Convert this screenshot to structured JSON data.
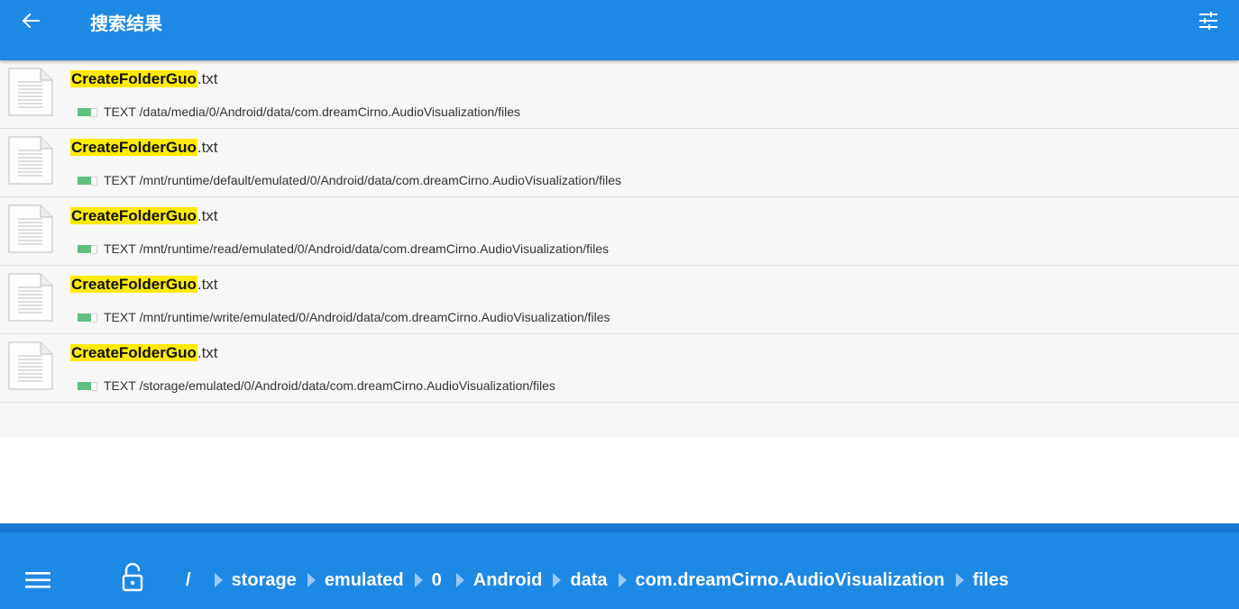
{
  "app_bar": {
    "title": "搜索结果",
    "back_icon": "arrow-left-icon",
    "filter_icon": "tune-sliders-icon",
    "color": "#1e88e5"
  },
  "results": [
    {
      "name_highlight": "CreateFolderGuo",
      "name_rest": ".txt",
      "type": "TEXT",
      "path": "/data/media/0/Android/data/com.dreamCirno.AudioVisualization/files"
    },
    {
      "name_highlight": "CreateFolderGuo",
      "name_rest": ".txt",
      "type": "TEXT",
      "path": "/mnt/runtime/default/emulated/0/Android/data/com.dreamCirno.AudioVisualization/files"
    },
    {
      "name_highlight": "CreateFolderGuo",
      "name_rest": ".txt",
      "type": "TEXT",
      "path": "/mnt/runtime/read/emulated/0/Android/data/com.dreamCirno.AudioVisualization/files"
    },
    {
      "name_highlight": "CreateFolderGuo",
      "name_rest": ".txt",
      "type": "TEXT",
      "path": "/mnt/runtime/write/emulated/0/Android/data/com.dreamCirno.AudioVisualization/files"
    },
    {
      "name_highlight": "CreateFolderGuo",
      "name_rest": ".txt",
      "type": "TEXT",
      "path": "/storage/emulated/0/Android/data/com.dreamCirno.AudioVisualization/files"
    }
  ],
  "highlight_color": "#ffeb00",
  "bottom_bar": {
    "menu_icon": "hamburger-menu-icon",
    "lock_icon": "unlocked-padlock-icon",
    "breadcrumbs": [
      "/",
      "storage",
      "emulated",
      "0",
      "Android",
      "data",
      "com.dreamCirno.AudioVisualization",
      "files"
    ]
  }
}
